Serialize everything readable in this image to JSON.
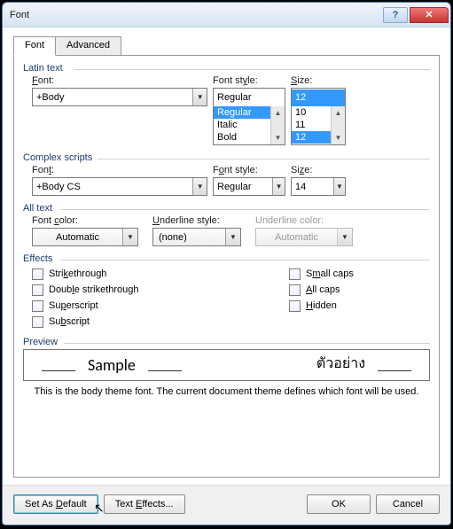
{
  "title": "Font",
  "tabs": {
    "font": "Font",
    "advanced": "Advanced"
  },
  "latin": {
    "group": "Latin text",
    "font_label": "Font:",
    "font_value": "+Body",
    "style_label": "Font style:",
    "style_value": "Regular",
    "style_options": [
      "Regular",
      "Italic",
      "Bold"
    ],
    "size_label": "Size:",
    "size_value": "12",
    "size_options": [
      "10",
      "11",
      "12"
    ]
  },
  "complex": {
    "group": "Complex scripts",
    "font_label": "Font:",
    "font_value": "+Body CS",
    "style_label": "Font style:",
    "style_value": "Regular",
    "size_label": "Size:",
    "size_value": "14"
  },
  "alltext": {
    "group": "All text",
    "color_label": "Font color:",
    "color_value": "Automatic",
    "ustyle_label": "Underline style:",
    "ustyle_value": "(none)",
    "ucolor_label": "Underline color:",
    "ucolor_value": "Automatic"
  },
  "effects": {
    "group": "Effects",
    "strike": "Strikethrough",
    "dstrike": "Double strikethrough",
    "super": "Superscript",
    "sub": "Subscript",
    "smallcaps": "Small caps",
    "allcaps": "All caps",
    "hidden": "Hidden"
  },
  "preview": {
    "group": "Preview",
    "sample1": "Sample",
    "sample2": "ตัวอย่าง",
    "desc": "This is the body theme font. The current document theme defines which font will be used."
  },
  "buttons": {
    "default": "Set As Default",
    "effects": "Text Effects...",
    "ok": "OK",
    "cancel": "Cancel"
  }
}
